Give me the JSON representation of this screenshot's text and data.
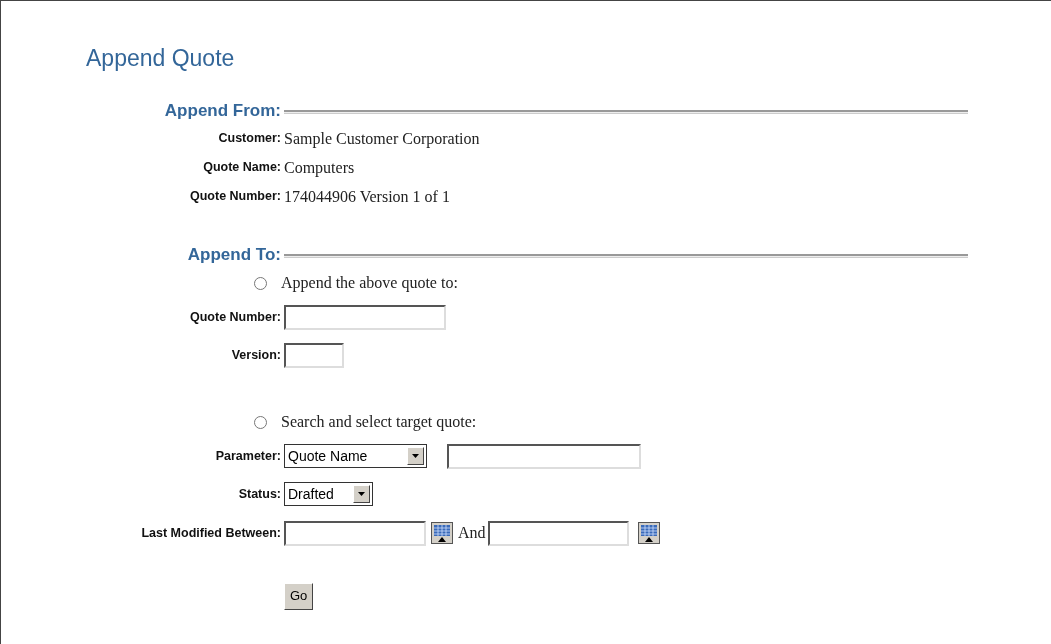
{
  "title": "Append Quote",
  "append_from": {
    "heading": "Append From:",
    "fields": [
      {
        "label": "Customer:",
        "value": "Sample Customer Corporation"
      },
      {
        "label": "Quote Name:",
        "value": "Computers"
      },
      {
        "label": "Quote Number:",
        "value": "174044906 Version 1 of 1"
      }
    ]
  },
  "append_to": {
    "heading": "Append To:",
    "options": [
      {
        "label": "Append the above quote to:",
        "selected": false
      },
      {
        "label": "Search and select target quote:",
        "selected": false
      }
    ],
    "quote_number": {
      "label": "Quote Number:"
    },
    "version": {
      "label": "Version:"
    },
    "parameter": {
      "label": "Parameter:",
      "value": "Quote Name"
    },
    "status": {
      "label": "Status:",
      "value": "Drafted"
    },
    "last_modified": {
      "label": "Last Modified Between:",
      "conjunction": "And"
    },
    "go_button": "Go"
  }
}
